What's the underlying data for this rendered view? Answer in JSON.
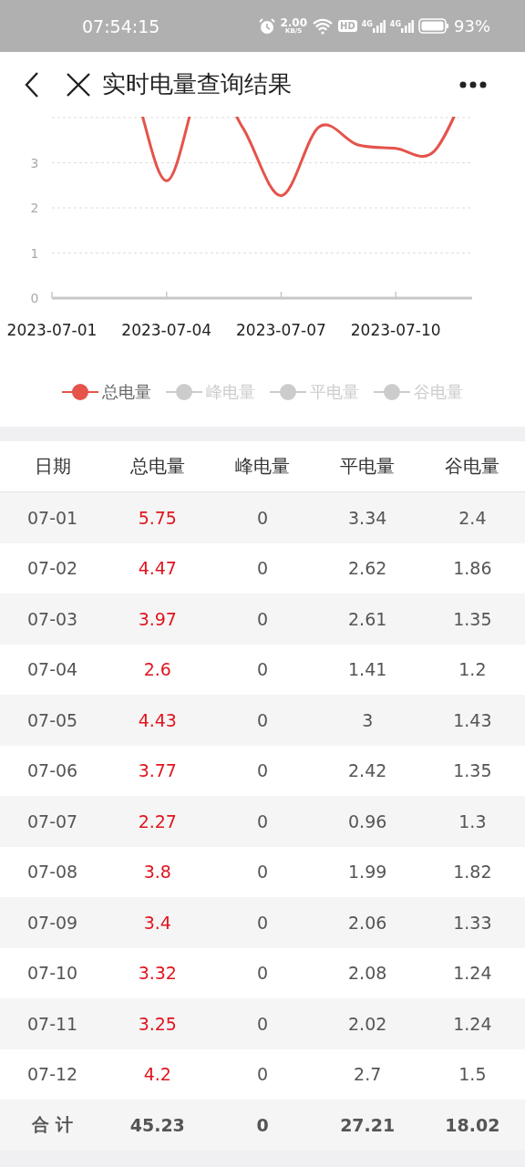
{
  "status_bar": {
    "time": "07:54:15",
    "speed": "2.00",
    "speed_unit": "KB/S",
    "hd": "HD",
    "signals": [
      "4G",
      "4G"
    ],
    "battery": "93%"
  },
  "header": {
    "title": "实时电量查询结果"
  },
  "chart": {
    "chart_data": {
      "type": "line",
      "categories": [
        "2023-07-01",
        null,
        null,
        "2023-07-04",
        null,
        null,
        "2023-07-07",
        null,
        null,
        "2023-07-10",
        null,
        null
      ],
      "series": [
        {
          "color": "#e5534b",
          "values": [
            null,
            null,
            null,
            2.6,
            null,
            3.77,
            2.27,
            3.8,
            3.4,
            3.32,
            3.25,
            null
          ]
        }
      ],
      "grid": true,
      "ylim": [
        0,
        4
      ],
      "yticks": [
        0,
        1,
        2,
        3
      ]
    },
    "legend": [
      {
        "label": "总电量",
        "selected": true
      },
      {
        "label": "峰电量",
        "selected": false
      },
      {
        "label": "平电量",
        "selected": false
      },
      {
        "label": "谷电量",
        "selected": false
      }
    ]
  },
  "table": {
    "columns": [
      "日期",
      "总电量",
      "峰电量",
      "平电量",
      "谷电量"
    ],
    "rows": [
      [
        "07-01",
        "5.75",
        "0",
        "3.34",
        "2.4"
      ],
      [
        "07-02",
        "4.47",
        "0",
        "2.62",
        "1.86"
      ],
      [
        "07-03",
        "3.97",
        "0",
        "2.61",
        "1.35"
      ],
      [
        "07-04",
        "2.6",
        "0",
        "1.41",
        "1.2"
      ],
      [
        "07-05",
        "4.43",
        "0",
        "3",
        "1.43"
      ],
      [
        "07-06",
        "3.77",
        "0",
        "2.42",
        "1.35"
      ],
      [
        "07-07",
        "2.27",
        "0",
        "0.96",
        "1.3"
      ],
      [
        "07-08",
        "3.8",
        "0",
        "1.99",
        "1.82"
      ],
      [
        "07-09",
        "3.4",
        "0",
        "2.06",
        "1.33"
      ],
      [
        "07-10",
        "3.32",
        "0",
        "2.08",
        "1.24"
      ],
      [
        "07-11",
        "3.25",
        "0",
        "2.02",
        "1.24"
      ],
      [
        "07-12",
        "4.2",
        "0",
        "2.7",
        "1.5"
      ]
    ],
    "total": [
      "合 计",
      "45.23",
      "0",
      "27.21",
      "18.02"
    ]
  }
}
